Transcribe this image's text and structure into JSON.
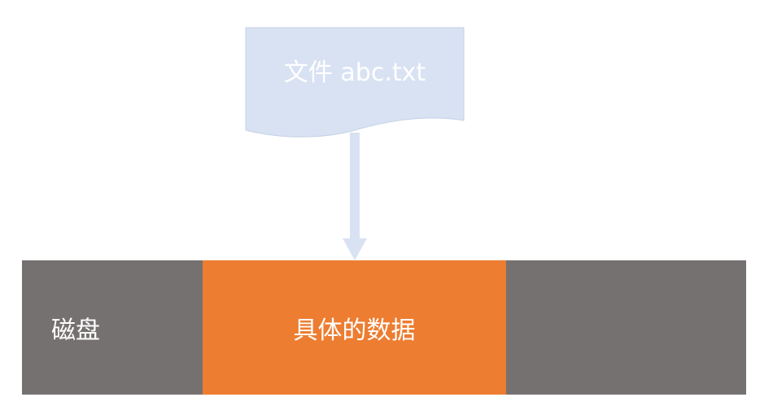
{
  "file": {
    "label": "文件 abc.txt"
  },
  "disk": {
    "label": "磁盘",
    "data_label": "具体的数据"
  },
  "colors": {
    "file_fill": "#D9E2F3",
    "file_stroke": "#C5D0E6",
    "arrow": "#D9E2F3",
    "disk_gray": "#767171",
    "data_orange": "#ED7D31",
    "text": "#FFFFFF"
  }
}
